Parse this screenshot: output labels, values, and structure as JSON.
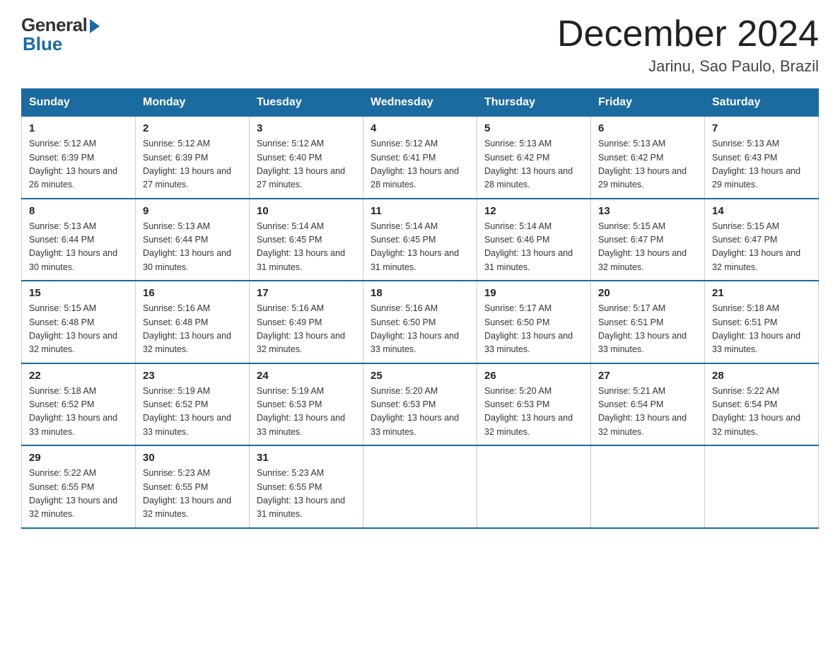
{
  "header": {
    "logo_general": "General",
    "logo_blue": "Blue",
    "month_title": "December 2024",
    "location": "Jarinu, Sao Paulo, Brazil"
  },
  "weekdays": [
    "Sunday",
    "Monday",
    "Tuesday",
    "Wednesday",
    "Thursday",
    "Friday",
    "Saturday"
  ],
  "weeks": [
    [
      {
        "day": "1",
        "sunrise": "5:12 AM",
        "sunset": "6:39 PM",
        "daylight": "13 hours and 26 minutes."
      },
      {
        "day": "2",
        "sunrise": "5:12 AM",
        "sunset": "6:39 PM",
        "daylight": "13 hours and 27 minutes."
      },
      {
        "day": "3",
        "sunrise": "5:12 AM",
        "sunset": "6:40 PM",
        "daylight": "13 hours and 27 minutes."
      },
      {
        "day": "4",
        "sunrise": "5:12 AM",
        "sunset": "6:41 PM",
        "daylight": "13 hours and 28 minutes."
      },
      {
        "day": "5",
        "sunrise": "5:13 AM",
        "sunset": "6:42 PM",
        "daylight": "13 hours and 28 minutes."
      },
      {
        "day": "6",
        "sunrise": "5:13 AM",
        "sunset": "6:42 PM",
        "daylight": "13 hours and 29 minutes."
      },
      {
        "day": "7",
        "sunrise": "5:13 AM",
        "sunset": "6:43 PM",
        "daylight": "13 hours and 29 minutes."
      }
    ],
    [
      {
        "day": "8",
        "sunrise": "5:13 AM",
        "sunset": "6:44 PM",
        "daylight": "13 hours and 30 minutes."
      },
      {
        "day": "9",
        "sunrise": "5:13 AM",
        "sunset": "6:44 PM",
        "daylight": "13 hours and 30 minutes."
      },
      {
        "day": "10",
        "sunrise": "5:14 AM",
        "sunset": "6:45 PM",
        "daylight": "13 hours and 31 minutes."
      },
      {
        "day": "11",
        "sunrise": "5:14 AM",
        "sunset": "6:45 PM",
        "daylight": "13 hours and 31 minutes."
      },
      {
        "day": "12",
        "sunrise": "5:14 AM",
        "sunset": "6:46 PM",
        "daylight": "13 hours and 31 minutes."
      },
      {
        "day": "13",
        "sunrise": "5:15 AM",
        "sunset": "6:47 PM",
        "daylight": "13 hours and 32 minutes."
      },
      {
        "day": "14",
        "sunrise": "5:15 AM",
        "sunset": "6:47 PM",
        "daylight": "13 hours and 32 minutes."
      }
    ],
    [
      {
        "day": "15",
        "sunrise": "5:15 AM",
        "sunset": "6:48 PM",
        "daylight": "13 hours and 32 minutes."
      },
      {
        "day": "16",
        "sunrise": "5:16 AM",
        "sunset": "6:48 PM",
        "daylight": "13 hours and 32 minutes."
      },
      {
        "day": "17",
        "sunrise": "5:16 AM",
        "sunset": "6:49 PM",
        "daylight": "13 hours and 32 minutes."
      },
      {
        "day": "18",
        "sunrise": "5:16 AM",
        "sunset": "6:50 PM",
        "daylight": "13 hours and 33 minutes."
      },
      {
        "day": "19",
        "sunrise": "5:17 AM",
        "sunset": "6:50 PM",
        "daylight": "13 hours and 33 minutes."
      },
      {
        "day": "20",
        "sunrise": "5:17 AM",
        "sunset": "6:51 PM",
        "daylight": "13 hours and 33 minutes."
      },
      {
        "day": "21",
        "sunrise": "5:18 AM",
        "sunset": "6:51 PM",
        "daylight": "13 hours and 33 minutes."
      }
    ],
    [
      {
        "day": "22",
        "sunrise": "5:18 AM",
        "sunset": "6:52 PM",
        "daylight": "13 hours and 33 minutes."
      },
      {
        "day": "23",
        "sunrise": "5:19 AM",
        "sunset": "6:52 PM",
        "daylight": "13 hours and 33 minutes."
      },
      {
        "day": "24",
        "sunrise": "5:19 AM",
        "sunset": "6:53 PM",
        "daylight": "13 hours and 33 minutes."
      },
      {
        "day": "25",
        "sunrise": "5:20 AM",
        "sunset": "6:53 PM",
        "daylight": "13 hours and 33 minutes."
      },
      {
        "day": "26",
        "sunrise": "5:20 AM",
        "sunset": "6:53 PM",
        "daylight": "13 hours and 32 minutes."
      },
      {
        "day": "27",
        "sunrise": "5:21 AM",
        "sunset": "6:54 PM",
        "daylight": "13 hours and 32 minutes."
      },
      {
        "day": "28",
        "sunrise": "5:22 AM",
        "sunset": "6:54 PM",
        "daylight": "13 hours and 32 minutes."
      }
    ],
    [
      {
        "day": "29",
        "sunrise": "5:22 AM",
        "sunset": "6:55 PM",
        "daylight": "13 hours and 32 minutes."
      },
      {
        "day": "30",
        "sunrise": "5:23 AM",
        "sunset": "6:55 PM",
        "daylight": "13 hours and 32 minutes."
      },
      {
        "day": "31",
        "sunrise": "5:23 AM",
        "sunset": "6:55 PM",
        "daylight": "13 hours and 31 minutes."
      },
      null,
      null,
      null,
      null
    ]
  ]
}
